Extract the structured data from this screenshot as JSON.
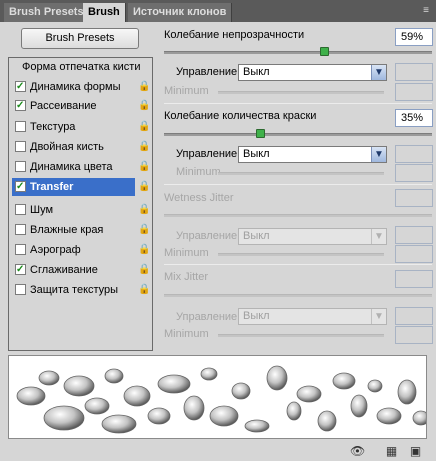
{
  "tabs": [
    "Brush Presets",
    "Brush",
    "Источник клонов"
  ],
  "presets_button": "Brush Presets",
  "list": {
    "header": "Форма отпечатка кисти",
    "items": [
      {
        "label": "Динамика формы",
        "checked": true
      },
      {
        "label": "Рассеивание",
        "checked": true
      },
      {
        "label": "Текстура",
        "checked": false
      },
      {
        "label": "Двойная кисть",
        "checked": false
      },
      {
        "label": "Динамика цвета",
        "checked": false
      },
      {
        "label": "Transfer",
        "checked": true,
        "selected": true
      },
      {
        "label": "Шум",
        "checked": false
      },
      {
        "label": "Влажные края",
        "checked": false
      },
      {
        "label": "Аэрограф",
        "checked": false
      },
      {
        "label": "Сглаживание",
        "checked": true
      },
      {
        "label": "Защита текстуры",
        "checked": false
      }
    ]
  },
  "settings": {
    "opacity_jitter": {
      "label": "Колебание непрозрачности",
      "value": "59%",
      "slider": 0.59
    },
    "opacity_control": {
      "label": "Управление:",
      "value": "Выкл"
    },
    "opacity_minimum": {
      "label": "Minimum"
    },
    "flow_jitter": {
      "label": "Колебание количества краски",
      "value": "35%",
      "slider": 0.35
    },
    "flow_control": {
      "label": "Управление:",
      "value": "Выкл"
    },
    "flow_minimum": {
      "label": "Minimum"
    },
    "wetness_jitter": {
      "label": "Wetness Jitter"
    },
    "wetness_control": {
      "label": "Управление:",
      "value": "Выкл"
    },
    "wetness_minimum": {
      "label": "Minimum"
    },
    "mix_jitter": {
      "label": "Mix Jitter"
    },
    "mix_control": {
      "label": "Управление:",
      "value": "Выкл"
    },
    "mix_minimum": {
      "label": "Minimum"
    }
  },
  "icons": {
    "panel_menu": "panel-menu-icon",
    "lock": "lock-icon",
    "eye": "eye-brush-icon",
    "grid": "grid-icon",
    "new": "new-preset-icon"
  }
}
